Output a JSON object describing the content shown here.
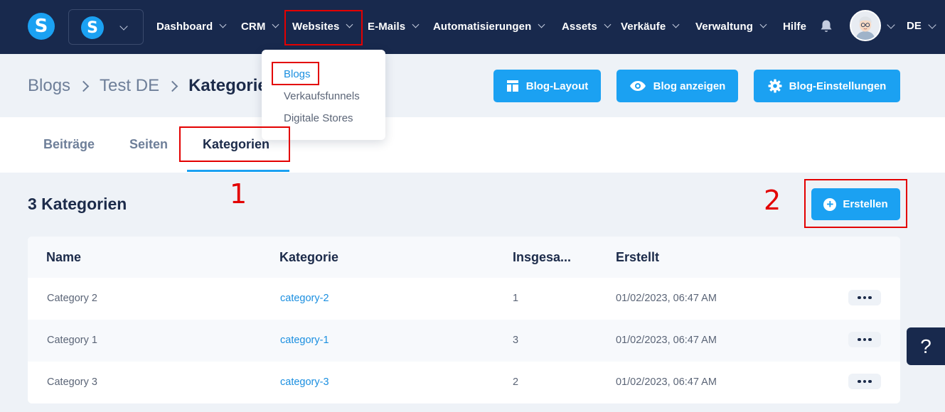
{
  "nav": {
    "logo_letter": "S",
    "items": [
      "Dashboard",
      "CRM",
      "Websites",
      "E-Mails",
      "Automatisierungen",
      "Assets",
      "Verkäufe",
      "Verwaltung",
      "Hilfe"
    ],
    "language": "DE"
  },
  "dropdown": {
    "items": [
      "Blogs",
      "Verkaufsfunnels",
      "Digitale Stores"
    ],
    "active": "Blogs"
  },
  "breadcrumb": [
    "Blogs",
    "Test DE",
    "Kategorien"
  ],
  "header_buttons": {
    "layout": "Blog-Layout",
    "view": "Blog anzeigen",
    "settings": "Blog-Einstellungen"
  },
  "tabs": [
    "Beiträge",
    "Seiten",
    "Kategorien"
  ],
  "active_tab": "Kategorien",
  "annotations": {
    "step1": "1",
    "step2": "2"
  },
  "content": {
    "count_title": "3 Kategorien",
    "create_label": "Erstellen"
  },
  "table": {
    "headers": [
      "Name",
      "Kategorie",
      "Insgesa...",
      "Erstellt"
    ],
    "rows": [
      {
        "name": "Category 2",
        "slug": "category-2",
        "total": "1",
        "created": "01/02/2023, 06:47 AM"
      },
      {
        "name": "Category 1",
        "slug": "category-1",
        "total": "3",
        "created": "01/02/2023, 06:47 AM"
      },
      {
        "name": "Category 3",
        "slug": "category-3",
        "total": "2",
        "created": "01/02/2023, 06:47 AM"
      }
    ]
  },
  "help": {
    "label": "?"
  },
  "colors": {
    "nav_bg": "#18294d",
    "accent": "#1ba1f2",
    "annotation_red": "#e30000",
    "page_bg": "#eef2f7"
  }
}
